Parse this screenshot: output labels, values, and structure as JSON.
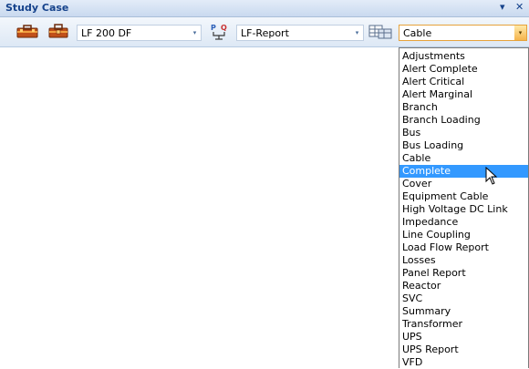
{
  "window": {
    "title": "Study Case",
    "menu_glyph": "▾",
    "close_glyph": "✕"
  },
  "toolbar": {
    "icons": [
      "toolbox-icon",
      "toolbox-open-icon",
      "report-settings-icon",
      "table-view-icon"
    ],
    "study_case_select": {
      "value": "LF 200 DF",
      "arrow": "▾"
    },
    "report_select": {
      "value": "LF-Report",
      "arrow": "▾"
    },
    "output_select": {
      "value": "Cable",
      "arrow": "▾"
    }
  },
  "dropdown": {
    "selected_index": 9,
    "options": [
      "Adjustments",
      "Alert Complete",
      "Alert Critical",
      "Alert Marginal",
      "Branch",
      "Branch Loading",
      "Bus",
      "Bus Loading",
      "Cable",
      "Complete",
      "Cover",
      "Equipment Cable",
      "High Voltage DC Link",
      "Impedance",
      "Line Coupling",
      "Load Flow Report",
      "Losses",
      "Panel Report",
      "Reactor",
      "SVC",
      "Summary",
      "Transformer",
      "UPS",
      "UPS Report",
      "VFD"
    ]
  },
  "colors": {
    "title_text": "#15428b",
    "selection": "#3399ff",
    "active_arrow": "#f5b44d"
  }
}
